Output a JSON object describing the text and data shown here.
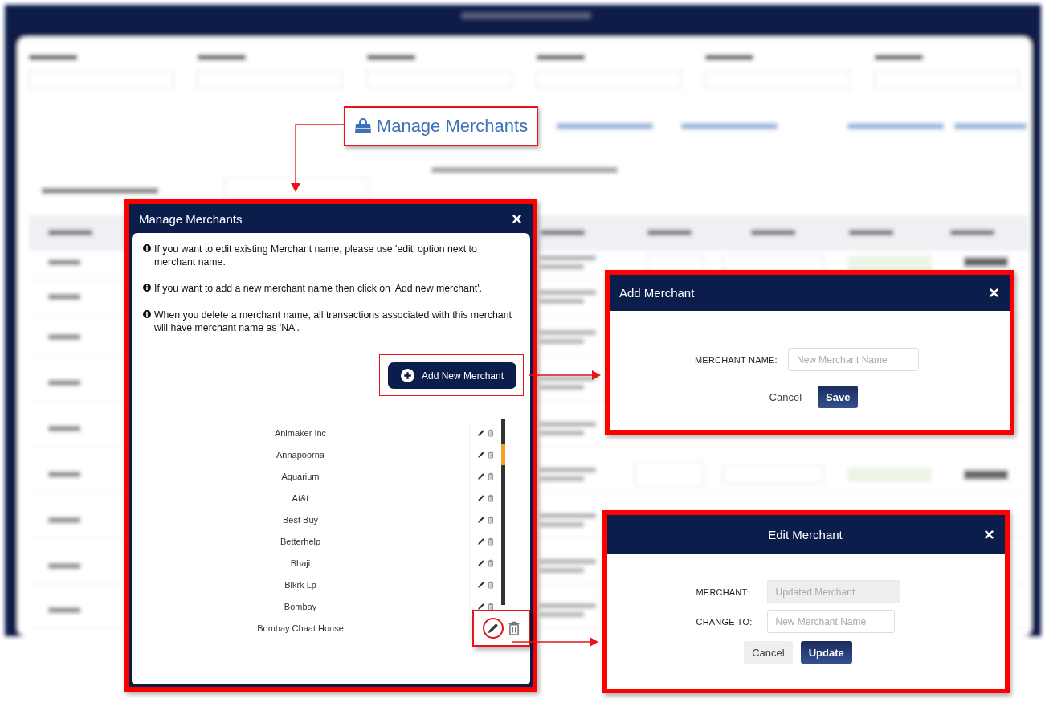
{
  "feature_link": {
    "label": "Manage Merchants"
  },
  "manage_modal": {
    "title": "Manage Merchants",
    "notes": [
      "If you want to edit existing Merchant name, please use 'edit' option next to merchant name.",
      "If you want to add a new merchant name then click on 'Add new merchant'.",
      "When you delete a merchant name, all transactions associated with this merchant will have merchant name as 'NA'."
    ],
    "add_button": {
      "label": "Add New Merchant"
    },
    "merchants": [
      {
        "name": "Animaker Inc",
        "highlighted": false
      },
      {
        "name": "Annapoorna",
        "highlighted": false
      },
      {
        "name": "Aquarium",
        "highlighted": false
      },
      {
        "name": "At&t",
        "highlighted": false
      },
      {
        "name": "Best Buy",
        "highlighted": false
      },
      {
        "name": "Betterhelp",
        "highlighted": false
      },
      {
        "name": "Bhaji",
        "highlighted": false
      },
      {
        "name": "Blkrk Lp",
        "highlighted": false
      },
      {
        "name": "Bombay",
        "highlighted": false
      },
      {
        "name": "Bombay Chaat House",
        "highlighted": true
      }
    ]
  },
  "add_modal": {
    "title": "Add Merchant",
    "fields": [
      {
        "label": "MERCHANT NAME:",
        "placeholder": "New Merchant Name",
        "disabled": false
      }
    ],
    "buttons": [
      {
        "label": "Cancel",
        "kind": "link"
      },
      {
        "label": "Save",
        "kind": "primary"
      }
    ]
  },
  "edit_modal": {
    "title": "Edit Merchant",
    "fields": [
      {
        "label": "MERCHANT:",
        "value": "Updated Merchant",
        "disabled": true
      },
      {
        "label": "CHANGE TO:",
        "placeholder": "New Merchant Name",
        "disabled": false
      }
    ],
    "buttons": [
      {
        "label": "Cancel",
        "kind": "secondary"
      },
      {
        "label": "Update",
        "kind": "primary"
      }
    ]
  }
}
